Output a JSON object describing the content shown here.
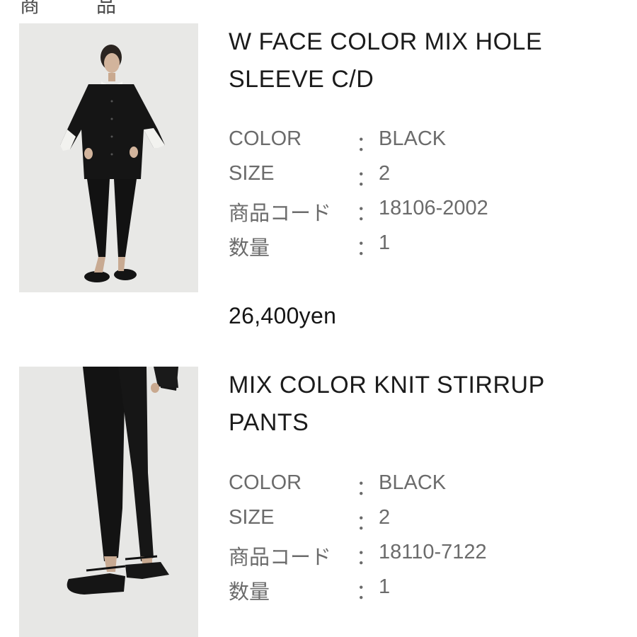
{
  "header": {
    "left_char": "商",
    "right_char": "品"
  },
  "products": [
    {
      "title_line1": "W FACE COLOR MIX HOLE",
      "title_line2": "SLEEVE C/D",
      "image_icon": "cardigan-model-photo",
      "specs": [
        {
          "label": "COLOR",
          "value": "BLACK"
        },
        {
          "label": "SIZE",
          "value": "2"
        },
        {
          "label": "商品コード",
          "value": "18106-2002"
        },
        {
          "label": "数量",
          "value": "1"
        }
      ],
      "price": "26,400yen"
    },
    {
      "title_line1": "MIX COLOR KNIT STIRRUP",
      "title_line2": "PANTS",
      "image_icon": "stirrup-pants-model-photo",
      "specs": [
        {
          "label": "COLOR",
          "value": "BLACK"
        },
        {
          "label": "SIZE",
          "value": "2"
        },
        {
          "label": "商品コード",
          "value": "18110-7122"
        },
        {
          "label": "数量",
          "value": "1"
        }
      ]
    }
  ],
  "separator": "：",
  "colors": {
    "photo_bg": "#e6e6e4",
    "garment": "#141414",
    "text_muted": "#6b6b6b"
  }
}
